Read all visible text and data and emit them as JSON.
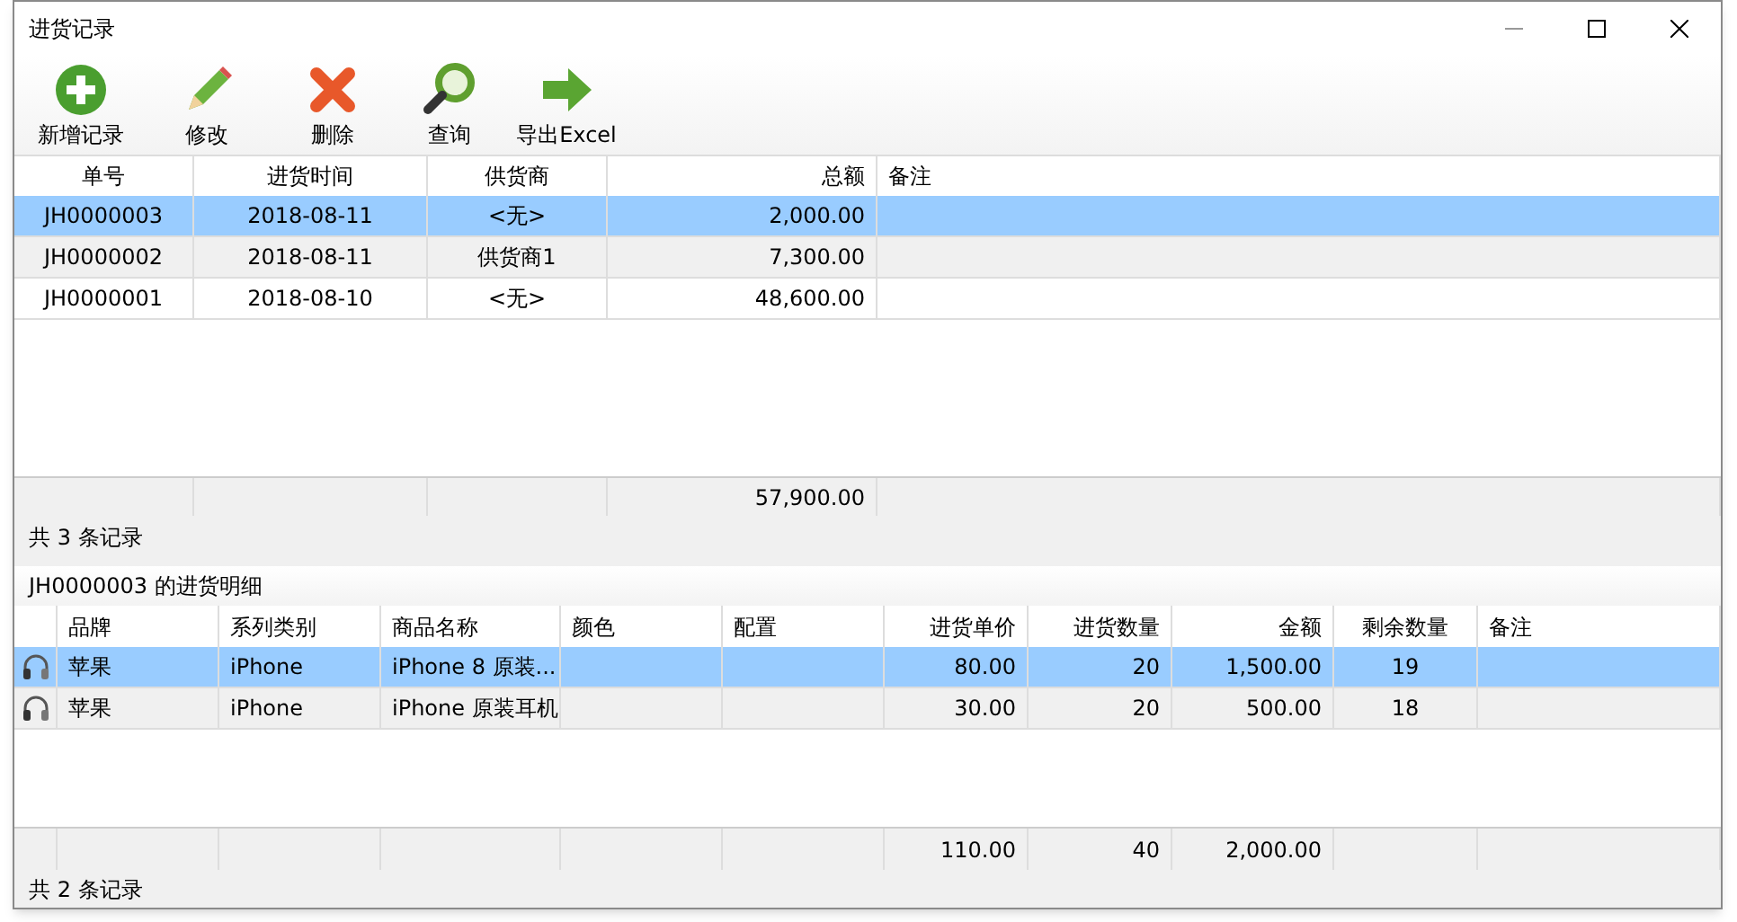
{
  "window": {
    "title": "进货记录"
  },
  "toolbar": [
    {
      "kind": "add",
      "label": "新增记录"
    },
    {
      "kind": "edit",
      "label": "修改"
    },
    {
      "kind": "delete",
      "label": "删除"
    },
    {
      "kind": "search",
      "label": "查询"
    },
    {
      "kind": "export",
      "label": "导出Excel"
    }
  ],
  "orders": {
    "columns": [
      {
        "label": "单号"
      },
      {
        "label": "进货时间"
      },
      {
        "label": "供货商"
      },
      {
        "label": "总额",
        "total": "57,900.00"
      },
      {
        "label": "备注"
      }
    ],
    "rows": [
      {
        "selected": true,
        "cells": [
          "JH0000003",
          "2018-08-11",
          "<无>",
          "2,000.00"
        ]
      },
      {
        "selected": false,
        "cells": [
          "JH0000002",
          "2018-08-11",
          "供货商1",
          "7,300.00"
        ]
      },
      {
        "selected": false,
        "cells": [
          "JH0000001",
          "2018-08-10",
          "<无>",
          "48,600.00"
        ]
      }
    ],
    "status": "共 3 条记录"
  },
  "details": {
    "title": "JH0000003 的进货明细",
    "columns": [
      {
        "label": "品牌"
      },
      {
        "label": "系列类别"
      },
      {
        "label": "商品名称"
      },
      {
        "label": "颜色"
      },
      {
        "label": "配置"
      },
      {
        "label": "进货单价",
        "total": "110.00"
      },
      {
        "label": "进货数量",
        "total": "40"
      },
      {
        "label": "金额",
        "total": "2,000.00"
      },
      {
        "label": "剩余数量"
      },
      {
        "label": "备注"
      }
    ],
    "rows": [
      {
        "selected": true,
        "cells": [
          "苹果",
          "iPhone",
          "iPhone 8 原装...",
          null,
          null,
          "80.00",
          "20",
          "1,500.00",
          "19"
        ]
      },
      {
        "selected": false,
        "cells": [
          "苹果",
          "iPhone",
          "iPhone 原装耳机",
          null,
          null,
          "30.00",
          "20",
          "500.00",
          "18"
        ]
      }
    ],
    "status": "共 2 条记录"
  }
}
